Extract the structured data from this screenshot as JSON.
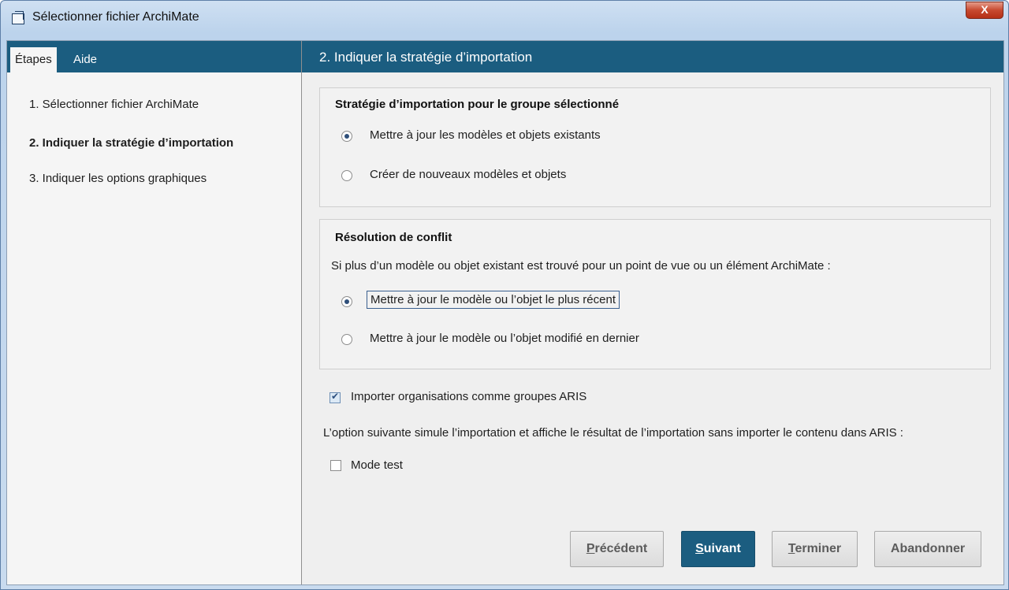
{
  "window": {
    "title": "Sélectionner fichier ArchiMate",
    "close_label": "X"
  },
  "tabs": [
    {
      "label": "Étapes"
    },
    {
      "label": "Aide"
    }
  ],
  "steps": [
    {
      "label": "1. Sélectionner fichier ArchiMate",
      "active": false
    },
    {
      "label": "2. Indiquer la stratégie d’importation",
      "active": true
    },
    {
      "label": "3. Indiquer les options graphiques",
      "active": false
    }
  ],
  "header": {
    "title": "2. Indiquer la stratégie d’importation"
  },
  "import_strategy": {
    "title": "Stratégie d’importation pour le groupe sélectionné",
    "options": [
      {
        "label": "Mettre à jour les modèles et objets existants",
        "checked": true
      },
      {
        "label": "Créer de nouveaux modèles et objets",
        "checked": false
      }
    ]
  },
  "conflict": {
    "title": "Résolution de conflit",
    "description": "Si plus d’un modèle ou objet existant est trouvé pour un point de vue ou un élément ArchiMate :",
    "options": [
      {
        "label": "Mettre à jour le modèle ou l’objet le plus récent",
        "checked": true
      },
      {
        "label": "Mettre à jour le modèle ou l’objet modifié en dernier",
        "checked": false
      }
    ]
  },
  "import_orgs": {
    "label": "Importer organisations comme groupes ARIS",
    "checked": true
  },
  "test_note": "L’option suivante simule l’importation et affiche le résultat de l’importation sans importer le contenu dans ARIS :",
  "test_mode": {
    "label": "Mode test",
    "checked": false
  },
  "buttons": {
    "previous": {
      "mnemonic": "P",
      "rest": "récédent"
    },
    "next": {
      "mnemonic": "S",
      "rest": "uivant"
    },
    "finish": {
      "mnemonic": "T",
      "rest": "erminer"
    },
    "cancel": {
      "label": "Abandonner"
    }
  },
  "colors": {
    "accent": "#1b5d80",
    "panel": "#f0f0f0"
  }
}
